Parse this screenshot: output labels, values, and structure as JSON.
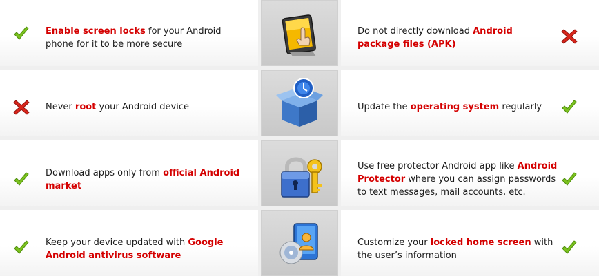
{
  "tips": [
    {
      "left": {
        "status": "do",
        "status_icon": "check-icon",
        "segments": [
          {
            "text": "Enable screen locks",
            "highlight": true
          },
          {
            "text": " for your Android phone for it to be more secure",
            "highlight": false
          }
        ]
      },
      "center_icon": "tablet-touch-icon",
      "right": {
        "status": "dont",
        "status_icon": "cross-icon",
        "segments": [
          {
            "text": "Do not directly download ",
            "highlight": false
          },
          {
            "text": "Android package files (APK)",
            "highlight": true
          }
        ]
      }
    },
    {
      "left": {
        "status": "dont",
        "status_icon": "cross-icon",
        "segments": [
          {
            "text": "Never ",
            "highlight": false
          },
          {
            "text": "root",
            "highlight": true
          },
          {
            "text": " your Android device",
            "highlight": false
          }
        ]
      },
      "center_icon": "software-box-icon",
      "right": {
        "status": "do",
        "status_icon": "check-icon",
        "segments": [
          {
            "text": "Update the ",
            "highlight": false
          },
          {
            "text": "operating system",
            "highlight": true
          },
          {
            "text": " regularly",
            "highlight": false
          }
        ]
      }
    },
    {
      "left": {
        "status": "do",
        "status_icon": "check-icon",
        "segments": [
          {
            "text": "Download apps only from ",
            "highlight": false
          },
          {
            "text": "official Android market",
            "highlight": true
          }
        ]
      },
      "center_icon": "padlock-key-icon",
      "right": {
        "status": "do",
        "status_icon": "check-icon",
        "segments": [
          {
            "text": "Use free protector Android app like ",
            "highlight": false
          },
          {
            "text": "Android Protector",
            "highlight": true
          },
          {
            "text": " where you can assign passwords to text messages, mail accounts, etc.",
            "highlight": false
          }
        ]
      }
    },
    {
      "left": {
        "status": "do",
        "status_icon": "check-icon",
        "segments": [
          {
            "text": "Keep your device updated with ",
            "highlight": false
          },
          {
            "text": "Google Android antivirus software",
            "highlight": true
          }
        ]
      },
      "center_icon": "disc-user-icon",
      "right": {
        "status": "do",
        "status_icon": "check-icon",
        "segments": [
          {
            "text": "Customize your ",
            "highlight": false
          },
          {
            "text": "locked home screen",
            "highlight": true
          },
          {
            "text": " with the user’s information",
            "highlight": false
          }
        ]
      }
    }
  ],
  "colors": {
    "highlight": "#d40000",
    "check": "#7cc21f",
    "cross": "#d9261c"
  }
}
